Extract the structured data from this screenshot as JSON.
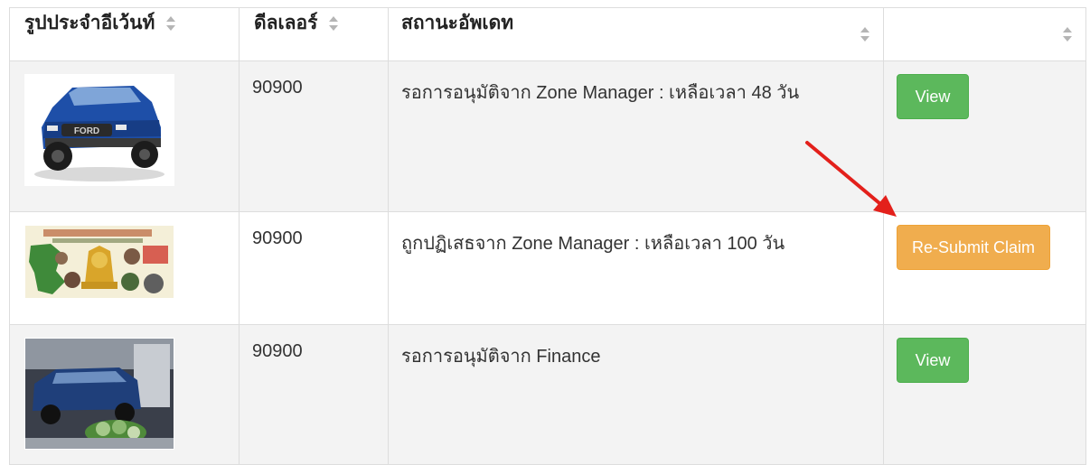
{
  "table": {
    "headers": [
      {
        "label": "รูปประจำอีเว้นท์",
        "sortable": true
      },
      {
        "label": "ดีลเลอร์",
        "sortable": true
      },
      {
        "label": "สถานะอัพเดท",
        "sortable": true
      },
      {
        "label": "",
        "sortable": true
      }
    ],
    "rows": [
      {
        "image": "blue-pickup-truck-photo",
        "dealer": "90900",
        "status": "รอการอนุมัติจาก Zone Manager : เหลือเวลา 48 วัน",
        "action": {
          "label": "View",
          "style": "success"
        }
      },
      {
        "image": "event-poster-collage-photo",
        "dealer": "90900",
        "status": "ถูกปฏิเสธจาก Zone Manager : เหลือเวลา 100 วัน",
        "action": {
          "label": "Re-Submit Claim",
          "style": "warning"
        }
      },
      {
        "image": "showroom-truck-display-photo",
        "dealer": "90900",
        "status": "รอการอนุมัติจาก Finance",
        "action": {
          "label": "View",
          "style": "success"
        }
      }
    ]
  },
  "annotation": {
    "type": "red-arrow",
    "points_to": "Re-Submit Claim"
  },
  "colors": {
    "success": "#5cb85c",
    "warning": "#f0ad4e",
    "stripe": "#f3f3f3",
    "border": "#dddddd",
    "arrow": "#e3201b"
  }
}
